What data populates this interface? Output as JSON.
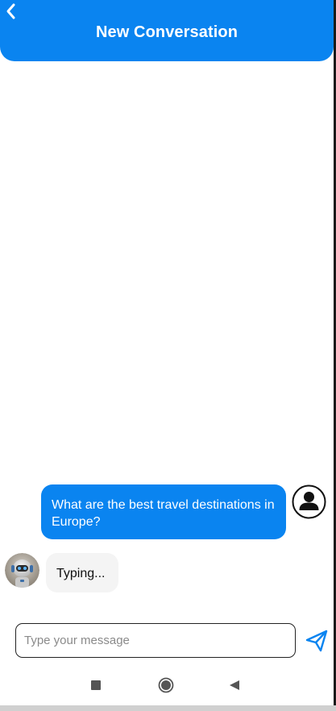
{
  "header": {
    "title": "New Conversation",
    "back_icon": "chevron-left-icon",
    "color": "#0a84f0"
  },
  "messages": [
    {
      "sender": "user",
      "text": "What are the best travel destinations in Europe?",
      "avatar_icon": "user-avatar-icon",
      "bubble_color": "#0a84f0"
    },
    {
      "sender": "bot",
      "text": "Typing...",
      "avatar_icon": "robot-avatar-icon",
      "bubble_color": "#f4f4f4"
    }
  ],
  "composer": {
    "placeholder": "Type your message",
    "value": "",
    "send_icon": "send-icon",
    "send_color": "#0a84f0"
  },
  "system_nav": {
    "recents_icon": "square-icon",
    "home_icon": "circle-icon",
    "back_icon": "triangle-back-icon"
  }
}
